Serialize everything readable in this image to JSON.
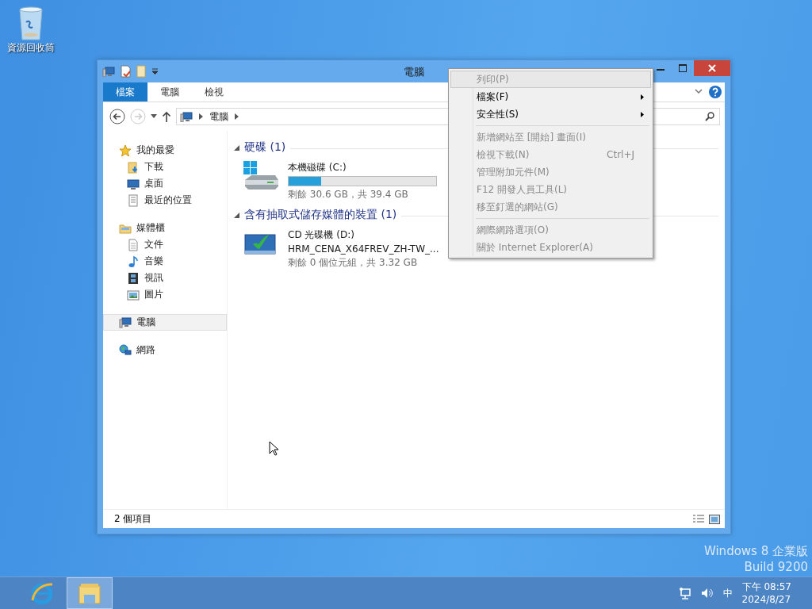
{
  "desktop": {
    "icons": [
      {
        "label": "資源回收筒"
      }
    ],
    "edition": "Windows 8 企業版",
    "build": "Build 9200"
  },
  "window": {
    "title": "電腦",
    "ribbon_tabs": [
      {
        "label": "檔案",
        "selected": true
      },
      {
        "label": "電腦",
        "selected": false
      },
      {
        "label": "檢視",
        "selected": false
      }
    ],
    "address": {
      "crumbs": [
        "電腦"
      ]
    },
    "nav": [
      {
        "label": "我的最愛",
        "kind": "favorites",
        "selected": false,
        "children": [
          {
            "label": "下載",
            "kind": "downloads",
            "selected": false
          },
          {
            "label": "桌面",
            "kind": "desktop",
            "selected": false
          },
          {
            "label": "最近的位置",
            "kind": "recent",
            "selected": false
          }
        ]
      },
      {
        "label": "媒體櫃",
        "kind": "libraries",
        "selected": false,
        "children": [
          {
            "label": "文件",
            "kind": "documents",
            "selected": false
          },
          {
            "label": "音樂",
            "kind": "music",
            "selected": false
          },
          {
            "label": "視訊",
            "kind": "videos",
            "selected": false
          },
          {
            "label": "圖片",
            "kind": "pictures",
            "selected": false
          }
        ]
      },
      {
        "label": "電腦",
        "kind": "computer",
        "selected": true
      },
      {
        "label": "網路",
        "kind": "network",
        "selected": false
      }
    ],
    "groups": [
      {
        "title": "硬碟 (1)",
        "expanded": true,
        "items": [
          {
            "kind": "drive",
            "name": "本機磁碟 (C:)",
            "level": 0.22,
            "detail": "剩餘 30.6 GB，共 39.4 GB"
          }
        ]
      },
      {
        "title": "含有抽取式儲存媒體的裝置 (1)",
        "expanded": true,
        "items": [
          {
            "kind": "cd",
            "name": "CD 光碟機 (D:)",
            "label": "HRM_CENA_X64FREV_ZH-TW_...",
            "detail": "剩餘 0 個位元組，共 3.32 GB"
          }
        ]
      }
    ],
    "status_bar": {
      "text": "2 個項目"
    }
  },
  "context_menu": {
    "items": [
      {
        "kind": "command",
        "label": "列印(P)",
        "disabled": true,
        "selected": true,
        "submenu": false
      },
      {
        "kind": "command",
        "label": "檔案(F)",
        "disabled": false,
        "selected": false,
        "submenu": true
      },
      {
        "kind": "command",
        "label": "安全性(S)",
        "disabled": false,
        "selected": false,
        "submenu": true
      },
      {
        "kind": "separator"
      },
      {
        "kind": "command",
        "label": "新增網站至 [開始] 畫面(I)",
        "disabled": true,
        "selected": false,
        "submenu": false
      },
      {
        "kind": "command",
        "label": "檢視下載(N)",
        "shortcut": "Ctrl+J",
        "disabled": true,
        "selected": false,
        "submenu": false
      },
      {
        "kind": "command",
        "label": "管理附加元件(M)",
        "disabled": true,
        "selected": false,
        "submenu": false
      },
      {
        "kind": "command",
        "label": "F12 開發人員工具(L)",
        "disabled": true,
        "selected": false,
        "submenu": false
      },
      {
        "kind": "command",
        "label": "移至釘選的網站(G)",
        "disabled": true,
        "selected": false,
        "submenu": false
      },
      {
        "kind": "separator"
      },
      {
        "kind": "command",
        "label": "網際網路選項(O)",
        "disabled": true,
        "selected": false,
        "submenu": false
      },
      {
        "kind": "command",
        "label": "關於 Internet Explorer(A)",
        "disabled": true,
        "selected": false,
        "submenu": false
      }
    ]
  },
  "taskbar": {
    "apps": [
      {
        "kind": "browser",
        "selected": false
      },
      {
        "kind": "explorer",
        "selected": true
      }
    ],
    "tray": {
      "input_method": "中",
      "time": "下午 08:57",
      "date": "2024/8/27"
    }
  }
}
